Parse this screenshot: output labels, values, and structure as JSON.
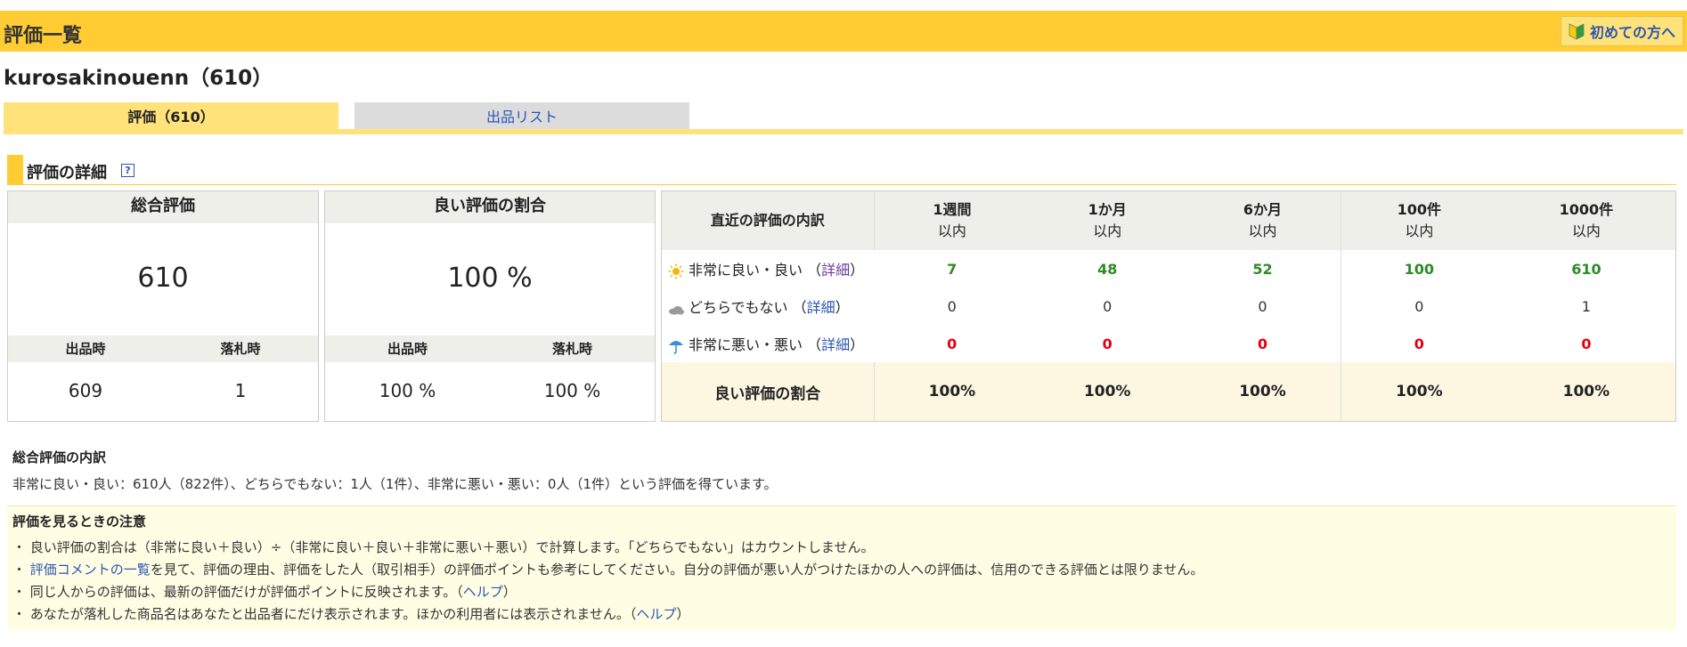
{
  "header": {
    "title": "評価一覧",
    "first_time_label": "初めての方へ"
  },
  "user": {
    "title": "kurosakinouenn（610）"
  },
  "tabs": [
    {
      "label": "評価（610）",
      "active": true
    },
    {
      "label": "出品リスト",
      "active": false
    }
  ],
  "section": {
    "title": "評価の詳細",
    "help_glyph": "?"
  },
  "overall": {
    "title": "総合評価",
    "value": "610",
    "sub_labels": [
      "出品時",
      "落札時"
    ],
    "sub_values": [
      "609",
      "1"
    ]
  },
  "good_ratio": {
    "title": "良い評価の割合",
    "value": "100 %",
    "sub_labels": [
      "出品時",
      "落札時"
    ],
    "sub_values": [
      "100 %",
      "100 %"
    ]
  },
  "recent": {
    "title": "直近の評価の内訳",
    "columns": [
      {
        "top": "1週間",
        "sub": "以内"
      },
      {
        "top": "1か月",
        "sub": "以内"
      },
      {
        "top": "6か月",
        "sub": "以内"
      },
      {
        "top": "100件",
        "sub": "以内"
      },
      {
        "top": "1000件",
        "sub": "以内"
      }
    ],
    "rows": [
      {
        "label": "非常に良い・良い",
        "detail": "詳細",
        "values": [
          "7",
          "48",
          "52",
          "100",
          "610"
        ]
      },
      {
        "label": "どちらでもない",
        "detail": "詳細",
        "values": [
          "0",
          "0",
          "0",
          "0",
          "1"
        ]
      },
      {
        "label": "非常に悪い・悪い",
        "detail": "詳細",
        "values": [
          "0",
          "0",
          "0",
          "0",
          "0"
        ]
      }
    ],
    "ratio_label": "良い評価の割合",
    "ratio_values": [
      "100%",
      "100%",
      "100%",
      "100%",
      "100%"
    ]
  },
  "breakdown": {
    "title": "総合評価の内訳",
    "text": "非常に良い・良い：610人（822件）、どちらでもない：1人（1件）、非常に悪い・悪い：0人（1件）という評価を得ています。"
  },
  "notice": {
    "title": "評価を見るときの注意",
    "item1": "・ 良い評価の割合は（非常に良い＋良い）÷（非常に良い＋良い＋非常に悪い＋悪い）で計算します。「どちらでもない」はカウントしません。",
    "item2_link": "評価コメントの一覧",
    "item2_text": "を見て、評価の理由、評価をした人（取引相手）の評価ポイントも参考にしてください。自分の評価が悪い人がつけたほかの人への評価は、信用のできる評価とは限りません。",
    "item3_text": "・ 同じ人からの評価は、最新の評価だけが評価ポイントに反映されます。（",
    "item4_text": "・ あなたが落札した商品名はあなたと出品者にだけ表示されます。ほかの利用者には表示されません。（",
    "help_link": "ヘルプ",
    "paren_close": "）",
    "bullet": "・ "
  },
  "colors": {
    "accent": "#ffcc33",
    "good": "#2e8b26",
    "bad": "#e60012",
    "link": "#2b56b3"
  }
}
